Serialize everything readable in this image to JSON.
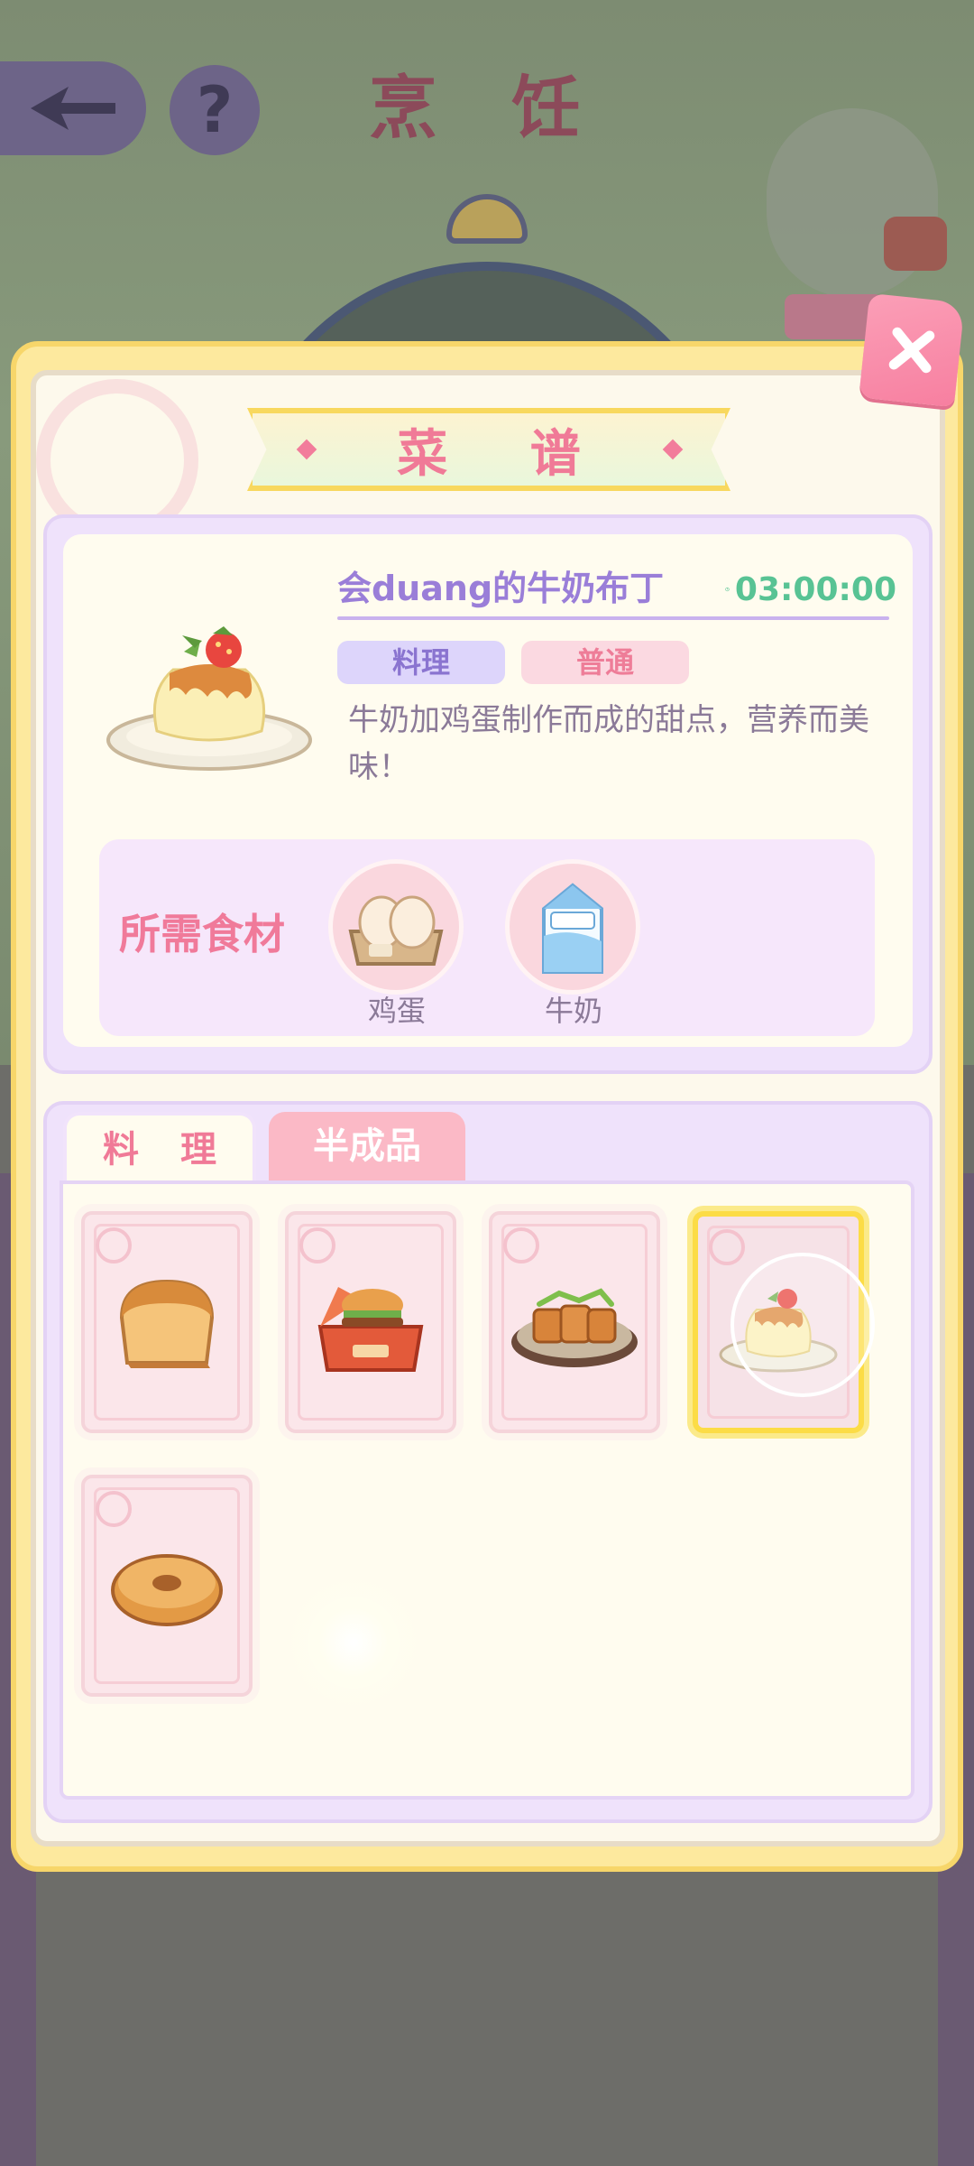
{
  "header": {
    "title": "烹 饪"
  },
  "dialog": {
    "title": "菜 谱"
  },
  "dish": {
    "name": "会duang的牛奶布丁",
    "timer": "03:00:00",
    "type_tag": "料理",
    "rarity_tag": "普通",
    "description": "牛奶加鸡蛋制作而成的甜点，营养而美味！",
    "image_icon": "pudding-icon"
  },
  "ingredients": {
    "label": "所需食材",
    "items": [
      {
        "name": "鸡蛋",
        "icon": "eggs-icon"
      },
      {
        "name": "牛奶",
        "icon": "milk-carton-icon"
      }
    ]
  },
  "tabs": [
    {
      "label": "料 理",
      "active": true
    },
    {
      "label": "半成品",
      "active": false
    }
  ],
  "recipes": [
    {
      "icon": "bread-icon",
      "selected": false
    },
    {
      "icon": "burger-box-icon",
      "selected": false
    },
    {
      "icon": "pork-cutlet-icon",
      "selected": false
    },
    {
      "icon": "pudding-icon",
      "selected": true
    },
    {
      "icon": "donut-icon",
      "selected": false
    }
  ],
  "colors": {
    "accent_pink": "#f07a97",
    "accent_purple": "#9a7ed8",
    "timer_green": "#58c394",
    "panel_yellow": "#fde99e",
    "selected_border": "#fcdc46"
  }
}
